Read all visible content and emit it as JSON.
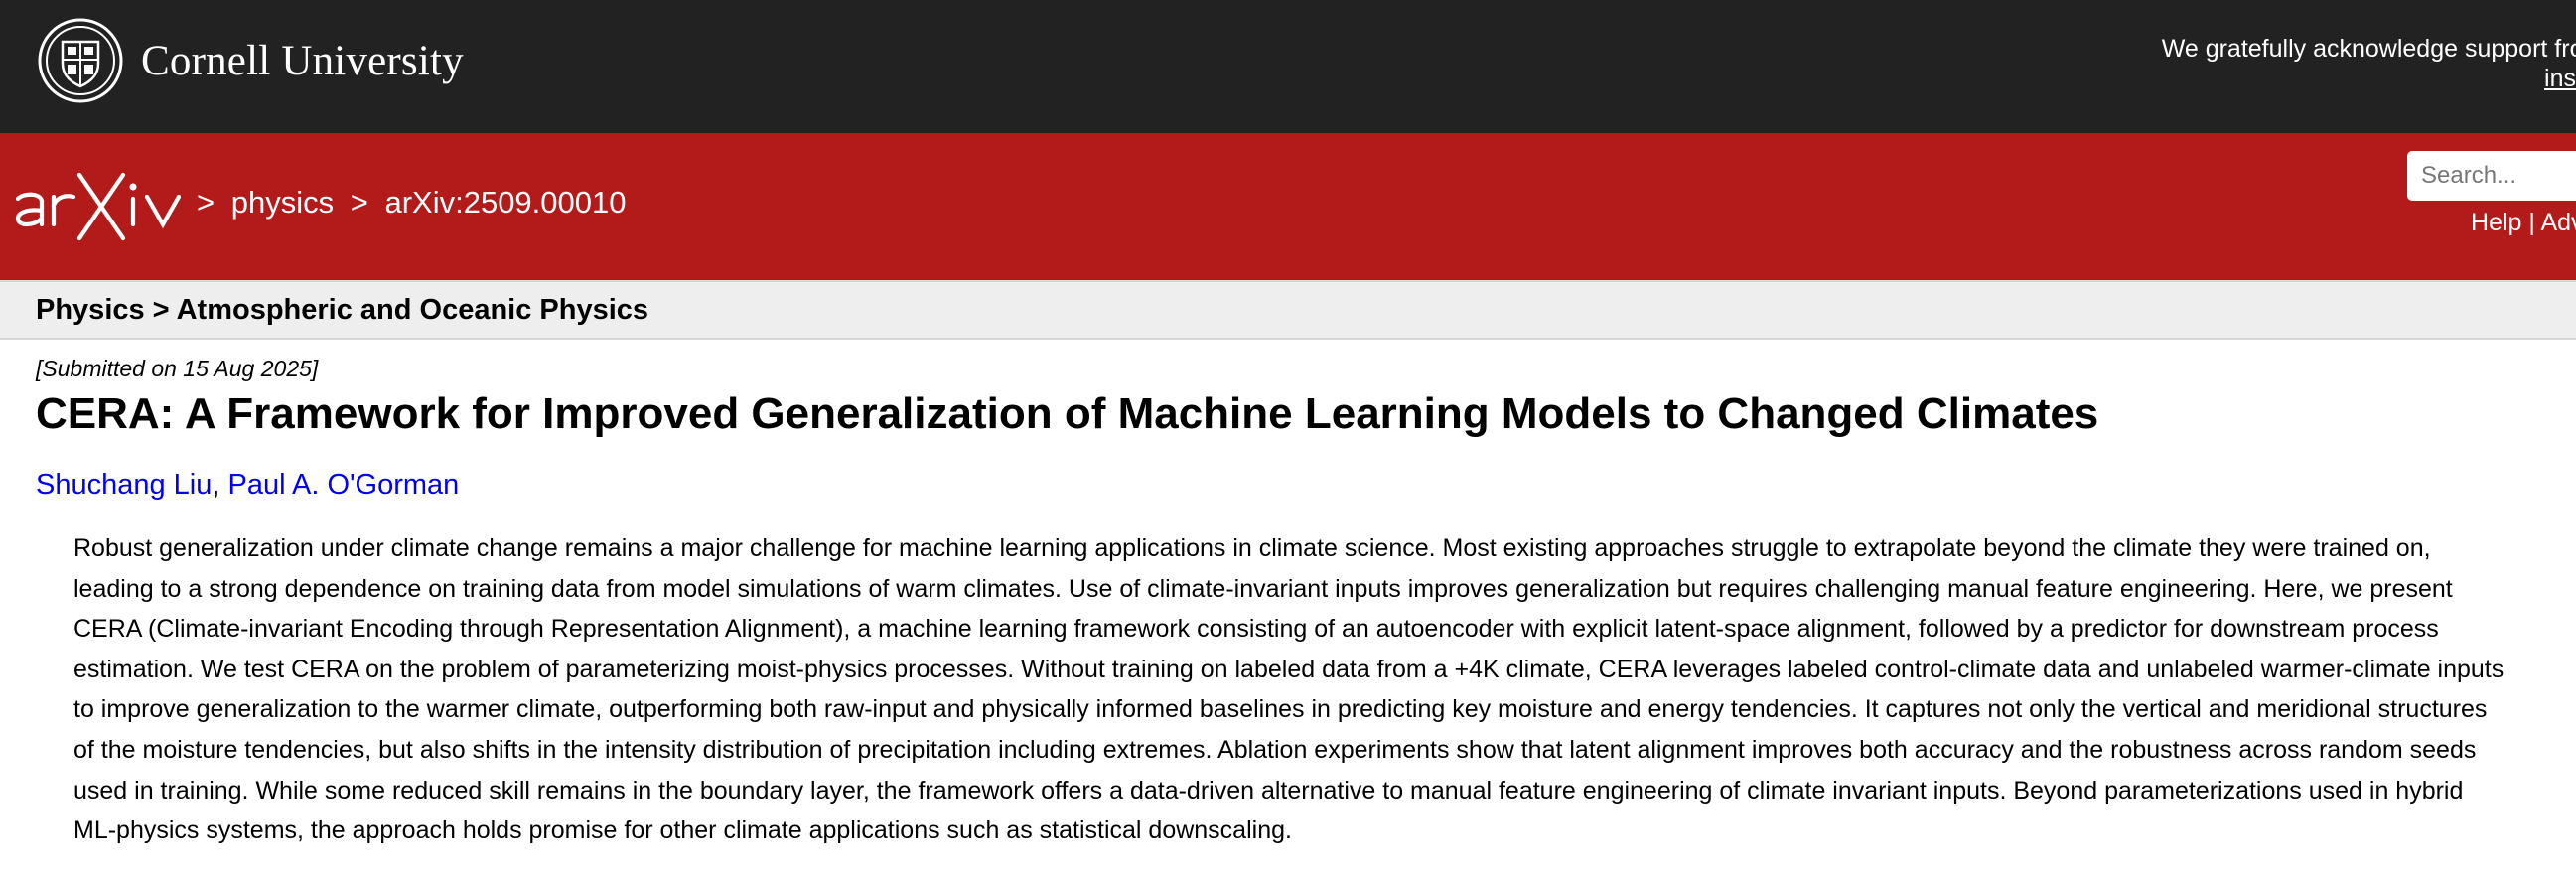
{
  "topbar": {
    "institution": "Cornell University",
    "support_text": "We gratefully acknowledge support from the",
    "support_link_text": "ins"
  },
  "header": {
    "logo": "arXiv",
    "breadcrumb": [
      ">",
      "physics",
      ">",
      "arXiv:2509.00010"
    ],
    "search_placeholder": "Search...",
    "help_label": "Help",
    "divider": "|",
    "advanced_label": "Adv"
  },
  "subject_path": "Physics > Atmospheric and Oceanic Physics",
  "paper": {
    "submitted": "[Submitted on 15 Aug 2025]",
    "title": "CERA: A Framework for Improved Generalization of Machine Learning Models to Changed Climates",
    "authors": [
      "Shuchang Liu",
      "Paul A. O'Gorman"
    ],
    "author_separator": ", ",
    "abstract": "Robust generalization under climate change remains a major challenge for machine learning applications in climate science. Most existing approaches struggle to extrapolate beyond the climate they were trained on, leading to a strong dependence on training data from model simulations of warm climates. Use of climate-invariant inputs improves generalization but requires challenging manual feature engineering. Here, we present CERA (Climate-invariant Encoding through Representation Alignment), a machine learning framework consisting of an autoencoder with explicit latent-space alignment, followed by a predictor for downstream process estimation. We test CERA on the problem of parameterizing moist-physics processes. Without training on labeled data from a +4K climate, CERA leverages labeled control-climate data and unlabeled warmer-climate inputs to improve generalization to the warmer climate, outperforming both raw-input and physically informed baselines in predicting key moisture and energy tendencies. It captures not only the vertical and meridional structures of the moisture tendencies, but also shifts in the intensity distribution of precipitation including extremes. Ablation experiments show that latent alignment improves both accuracy and the robustness across random seeds used in training. While some reduced skill remains in the boundary layer, the framework offers a data-driven alternative to manual feature engineering of climate invariant inputs. Beyond parameterizations used in hybrid ML-physics systems, the approach holds promise for other climate applications such as statistical downscaling."
  },
  "colors": {
    "topbar_bg": "#222222",
    "header_red": "#b31b1b",
    "subject_bg": "#eeeeee",
    "link_blue": "#0000ee"
  }
}
